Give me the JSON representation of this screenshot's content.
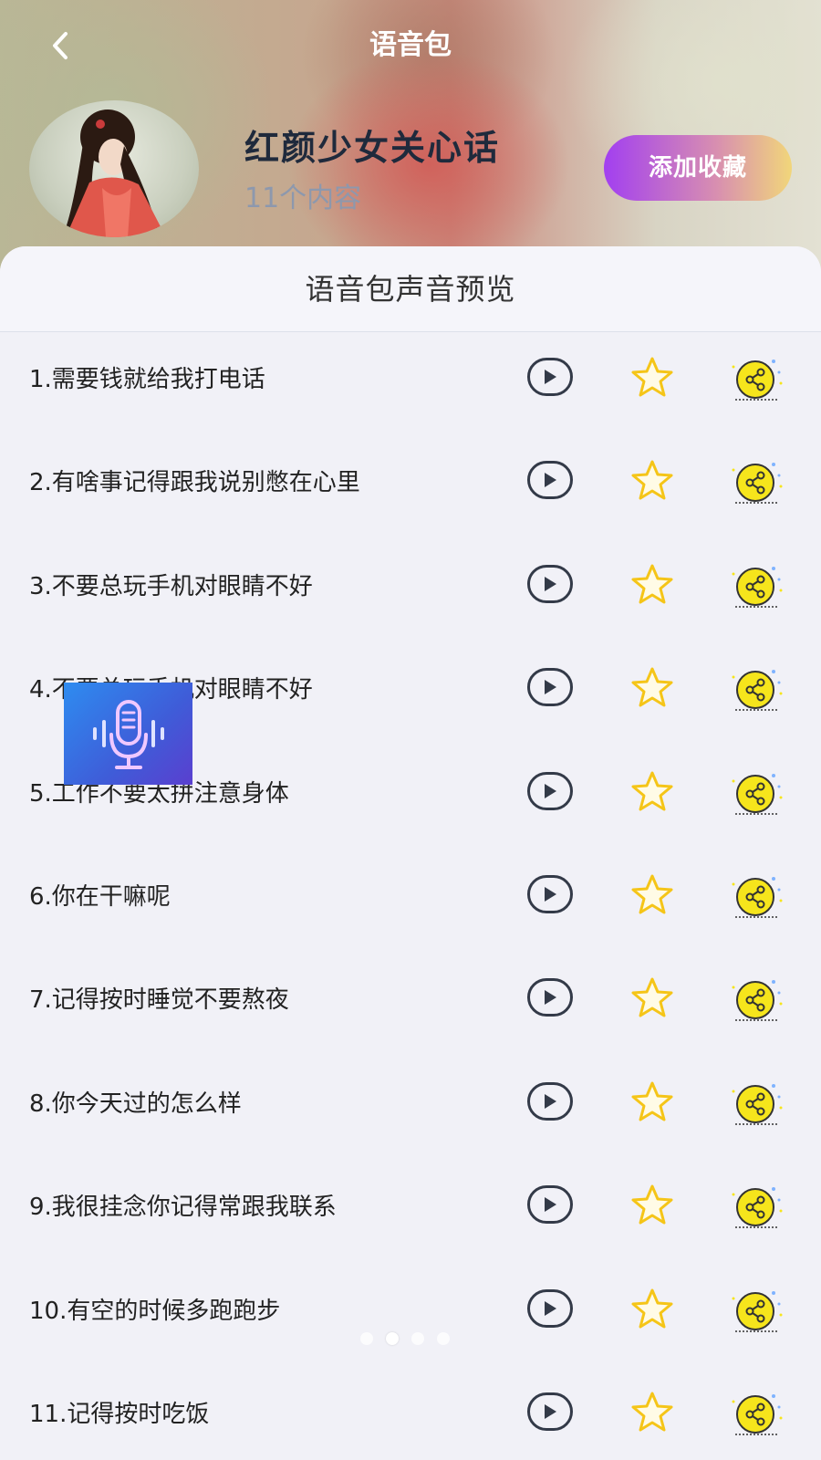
{
  "header": {
    "title": "语音包",
    "back_icon": "chevron-left-icon"
  },
  "pack": {
    "name": "红颜少女关心话",
    "count": "11个内容",
    "favorite_label": "添加收藏"
  },
  "preview": {
    "title": "语音包声音预览",
    "items": [
      {
        "text": "1.需要钱就给我打电话"
      },
      {
        "text": "2.有啥事记得跟我说别憋在心里"
      },
      {
        "text": "3.不要总玩手机对眼睛不好"
      },
      {
        "text": "4.不要总玩手机对眼睛不好"
      },
      {
        "text": "5.工作不要太拼注意身体"
      },
      {
        "text": "6.你在干嘛呢"
      },
      {
        "text": "7.记得按时睡觉不要熬夜"
      },
      {
        "text": "8.你今天过的怎么样"
      },
      {
        "text": "9.我很挂念你记得常跟我联系"
      },
      {
        "text": "10.有空的时候多跑跑步"
      },
      {
        "text": "11.记得按时吃饭"
      }
    ]
  },
  "colors": {
    "accent_start": "#a23ff0",
    "accent_end": "#f1d67a",
    "star": "#f5c518",
    "share_bg": "#f6e51c"
  },
  "icons": [
    "chevron-left-icon",
    "play-icon",
    "star-icon",
    "share-icon",
    "microphone-icon"
  ],
  "pager": {
    "count": 4,
    "active": 2
  }
}
